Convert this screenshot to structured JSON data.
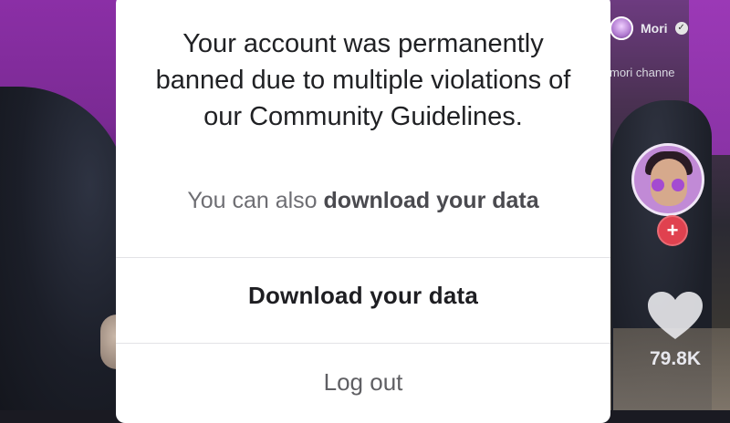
{
  "video": {
    "author_name": "Mori",
    "channel_text": "mori channe",
    "like_count": "79.8K"
  },
  "modal": {
    "message": "Your account was permanently banned due to multiple violations of our Community Guidelines.",
    "sub_prefix": "You can also ",
    "sub_bold": "download your data",
    "download_button_label": "Download your data",
    "logout_button_label": "Log out"
  },
  "icons": {
    "verified": "verified-badge-icon",
    "follow": "plus-icon",
    "like": "heart-icon"
  },
  "colors": {
    "accent_purple": "#8b2fa6",
    "follow_red": "#e0414f"
  }
}
